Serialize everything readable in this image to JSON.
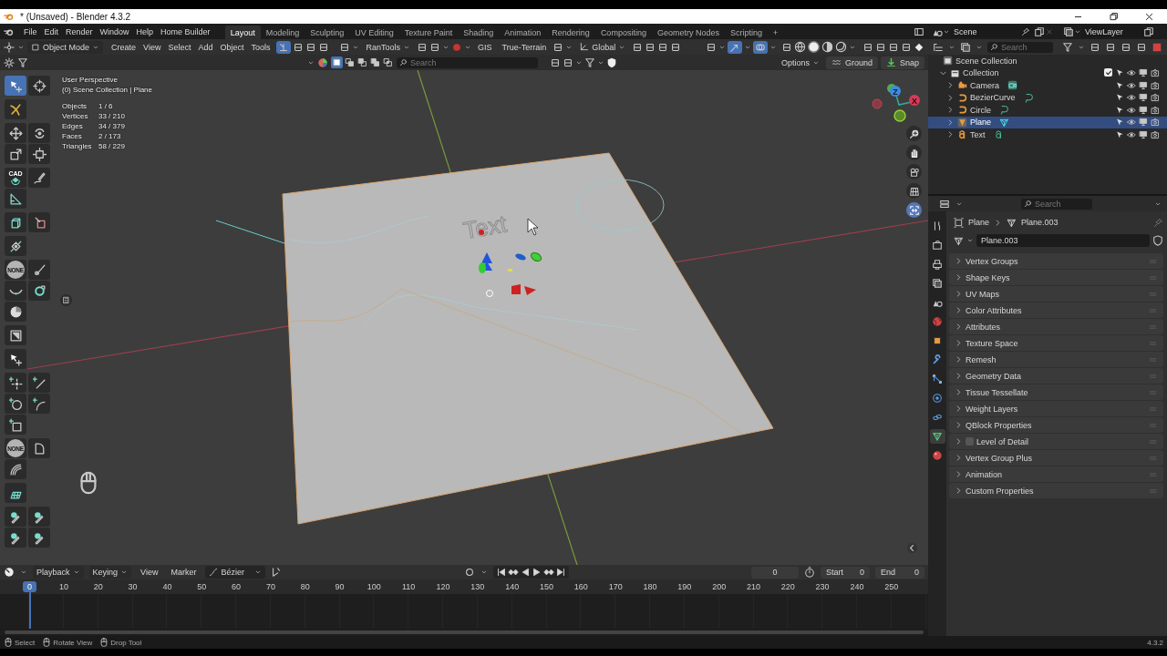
{
  "window": {
    "title": "* (Unsaved) - Blender 4.3.2"
  },
  "menu_bar": {
    "menus": [
      "File",
      "Edit",
      "Render",
      "Window",
      "Help",
      "Home Builder"
    ],
    "workspaces": [
      {
        "label": "Layout",
        "selected": true
      },
      {
        "label": "Modeling",
        "selected": false
      },
      {
        "label": "Sculpting",
        "selected": false
      },
      {
        "label": "UV Editing",
        "selected": false
      },
      {
        "label": "Texture Paint",
        "selected": false
      },
      {
        "label": "Shading",
        "selected": false
      },
      {
        "label": "Animation",
        "selected": false
      },
      {
        "label": "Rendering",
        "selected": false
      },
      {
        "label": "Compositing",
        "selected": false
      },
      {
        "label": "Geometry Nodes",
        "selected": false
      },
      {
        "label": "Scripting",
        "selected": false
      }
    ],
    "add_workspace": "+",
    "scene": "Scene",
    "view_layer": "ViewLayer"
  },
  "viewport_header": {
    "mode": "Object Mode",
    "menus": [
      "Create",
      "View",
      "Select",
      "Add",
      "Object",
      "Tools"
    ],
    "addon_menu": "RanTools",
    "addon_buttons": [
      "GIS",
      "True-Terrain"
    ],
    "orientation": "Global",
    "toggles": [
      {
        "kind": "snap",
        "on": true
      },
      {
        "kind": "gizmo",
        "on": true
      },
      {
        "kind": "overlay",
        "on": true
      }
    ],
    "shading": [
      {
        "kind": "wireframe",
        "selected": false
      },
      {
        "kind": "solid",
        "selected": true
      },
      {
        "kind": "material",
        "selected": false
      },
      {
        "kind": "rendered",
        "selected": false
      }
    ]
  },
  "tool_settings": {
    "select_modes": [
      {
        "kind": "set",
        "selected": true
      },
      {
        "kind": "extend",
        "selected": false
      },
      {
        "kind": "subtract",
        "selected": false
      },
      {
        "kind": "invert",
        "selected": false
      },
      {
        "kind": "intersect",
        "selected": false
      }
    ],
    "search": {
      "placeholder": "Search"
    },
    "options": "Options",
    "ground": "Ground",
    "snap": "Snap"
  },
  "viewport": {
    "view_name": "User Perspective",
    "collection": "(0) Scene Collection | Plane",
    "stats": [
      {
        "label": "Objects",
        "value": "1 / 6"
      },
      {
        "label": "Vertices",
        "value": "33 / 210"
      },
      {
        "label": "Edges",
        "value": "34 / 379"
      },
      {
        "label": "Faces",
        "value": "2 / 173"
      },
      {
        "label": "Triangles",
        "value": "58 / 229"
      }
    ],
    "scene_text": "Text",
    "axis_labels": [
      "Z",
      "X"
    ],
    "toolbar": [
      [
        {
          "kind": "select",
          "selected": true
        },
        {
          "kind": "cursor",
          "selected": false
        }
      ],
      [
        {
          "kind": "tweak",
          "selected": false
        }
      ],
      [
        {
          "kind": "move",
          "selected": false
        },
        {
          "kind": "rotate",
          "selected": false
        },
        {
          "kind": "scale",
          "selected": false
        },
        {
          "kind": "transform",
          "selected": false
        }
      ],
      [
        {
          "kind": "cad",
          "label": "CAD",
          "selected": false
        },
        {
          "kind": "annotate",
          "selected": false
        },
        {
          "kind": "measure",
          "selected": false
        }
      ],
      [
        {
          "kind": "add-cube",
          "selected": false
        },
        {
          "kind": "knife",
          "selected": false
        }
      ],
      [
        {
          "kind": "snap",
          "selected": false
        }
      ],
      [
        {
          "kind": "none",
          "label": "NONE",
          "selected": false
        },
        {
          "kind": "brush",
          "selected": false
        },
        {
          "kind": "curve",
          "selected": false
        },
        {
          "kind": "spin",
          "selected": false
        },
        {
          "kind": "pie",
          "selected": false
        }
      ],
      [
        {
          "kind": "frame",
          "selected": false
        }
      ],
      [
        {
          "kind": "select",
          "selected": false
        }
      ],
      [
        {
          "kind": "add-point",
          "selected": false
        },
        {
          "kind": "add-line",
          "selected": false
        },
        {
          "kind": "add-circle",
          "selected": false
        },
        {
          "kind": "add-arc",
          "selected": false
        },
        {
          "kind": "add-square",
          "selected": false
        }
      ],
      [
        {
          "kind": "none",
          "label": "NONE",
          "selected": false
        },
        {
          "kind": "corner",
          "selected": false
        },
        {
          "kind": "arc",
          "selected": false
        }
      ],
      [
        {
          "kind": "grid",
          "selected": false
        }
      ],
      [
        {
          "kind": "paint",
          "selected": false
        },
        {
          "kind": "paint",
          "selected": false
        },
        {
          "kind": "paint",
          "selected": false
        },
        {
          "kind": "paint",
          "selected": false
        }
      ]
    ]
  },
  "outliner": {
    "search": {
      "placeholder": "Search"
    },
    "tree": [
      {
        "label": "Scene Collection",
        "kind": "scene",
        "selected": false,
        "children": [
          {
            "label": "Collection",
            "kind": "collection",
            "expanded": true,
            "checked": true,
            "selected": false,
            "children": [
              {
                "label": "Camera",
                "kind": "camera",
                "expanded": false,
                "selected": false
              },
              {
                "label": "BezierCurve",
                "kind": "curve",
                "expanded": false,
                "selected": false
              },
              {
                "label": "Circle",
                "kind": "curve",
                "expanded": false,
                "selected": false
              },
              {
                "label": "Plane",
                "kind": "mesh",
                "expanded": false,
                "selected": true
              },
              {
                "label": "Text",
                "kind": "text",
                "expanded": false,
                "selected": false
              }
            ]
          }
        ]
      }
    ]
  },
  "properties": {
    "search": {
      "placeholder": "Search"
    },
    "tabs": [
      {
        "kind": "tool",
        "selected": false
      },
      {
        "kind": "render",
        "selected": false
      },
      {
        "kind": "output",
        "selected": false
      },
      {
        "kind": "view-layer",
        "selected": false
      },
      {
        "kind": "scene",
        "selected": false
      },
      {
        "kind": "world",
        "selected": false
      },
      {
        "kind": "object",
        "selected": false
      },
      {
        "kind": "modifiers",
        "selected": false
      },
      {
        "kind": "particles",
        "selected": false
      },
      {
        "kind": "physics",
        "selected": false
      },
      {
        "kind": "constraints",
        "selected": false
      },
      {
        "kind": "data",
        "selected": true
      },
      {
        "kind": "material",
        "selected": false
      }
    ],
    "breadcrumb": [
      "Plane",
      "Plane.003"
    ],
    "data_block": "Plane.003",
    "panels": [
      {
        "label": "Vertex Groups",
        "kind": "panel",
        "expanded": false
      },
      {
        "label": "Shape Keys",
        "kind": "panel",
        "expanded": false
      },
      {
        "label": "UV Maps",
        "kind": "panel",
        "expanded": false
      },
      {
        "label": "Color Attributes",
        "kind": "panel",
        "expanded": false
      },
      {
        "label": "Attributes",
        "kind": "panel",
        "expanded": false
      },
      {
        "label": "Texture Space",
        "kind": "panel",
        "expanded": false
      },
      {
        "label": "Remesh",
        "kind": "panel",
        "expanded": false
      },
      {
        "label": "Geometry Data",
        "kind": "panel",
        "expanded": false
      },
      {
        "label": "Tissue Tessellate",
        "kind": "panel",
        "expanded": false
      },
      {
        "label": "Weight Layers",
        "kind": "panel",
        "expanded": false
      },
      {
        "label": "QBlock Properties",
        "kind": "panel",
        "expanded": false
      },
      {
        "label": "Level of Detail",
        "kind": "checkbox",
        "checked": false,
        "expanded": false
      },
      {
        "label": "Vertex Group Plus",
        "kind": "panel",
        "expanded": false
      },
      {
        "label": "Animation",
        "kind": "panel",
        "expanded": false
      },
      {
        "label": "Custom Properties",
        "kind": "panel",
        "expanded": false
      }
    ]
  },
  "timeline": {
    "menus": [
      "Playback",
      "Keying",
      "View",
      "Marker"
    ],
    "interpolation": "Bézier",
    "current_frame": "0",
    "start_label": "Start",
    "start": "0",
    "end_label": "End",
    "end": "0",
    "playhead": "0",
    "ruler": [
      "10",
      "20",
      "30",
      "40",
      "50",
      "60",
      "70",
      "80",
      "90",
      "100",
      "110",
      "120",
      "130",
      "140",
      "150",
      "160",
      "170",
      "180",
      "190",
      "200",
      "210",
      "220",
      "230",
      "240",
      "250"
    ]
  },
  "status_bar": {
    "hints": [
      "Select",
      "Rotate View",
      "Drop Tool"
    ],
    "version": "4.3.2"
  }
}
